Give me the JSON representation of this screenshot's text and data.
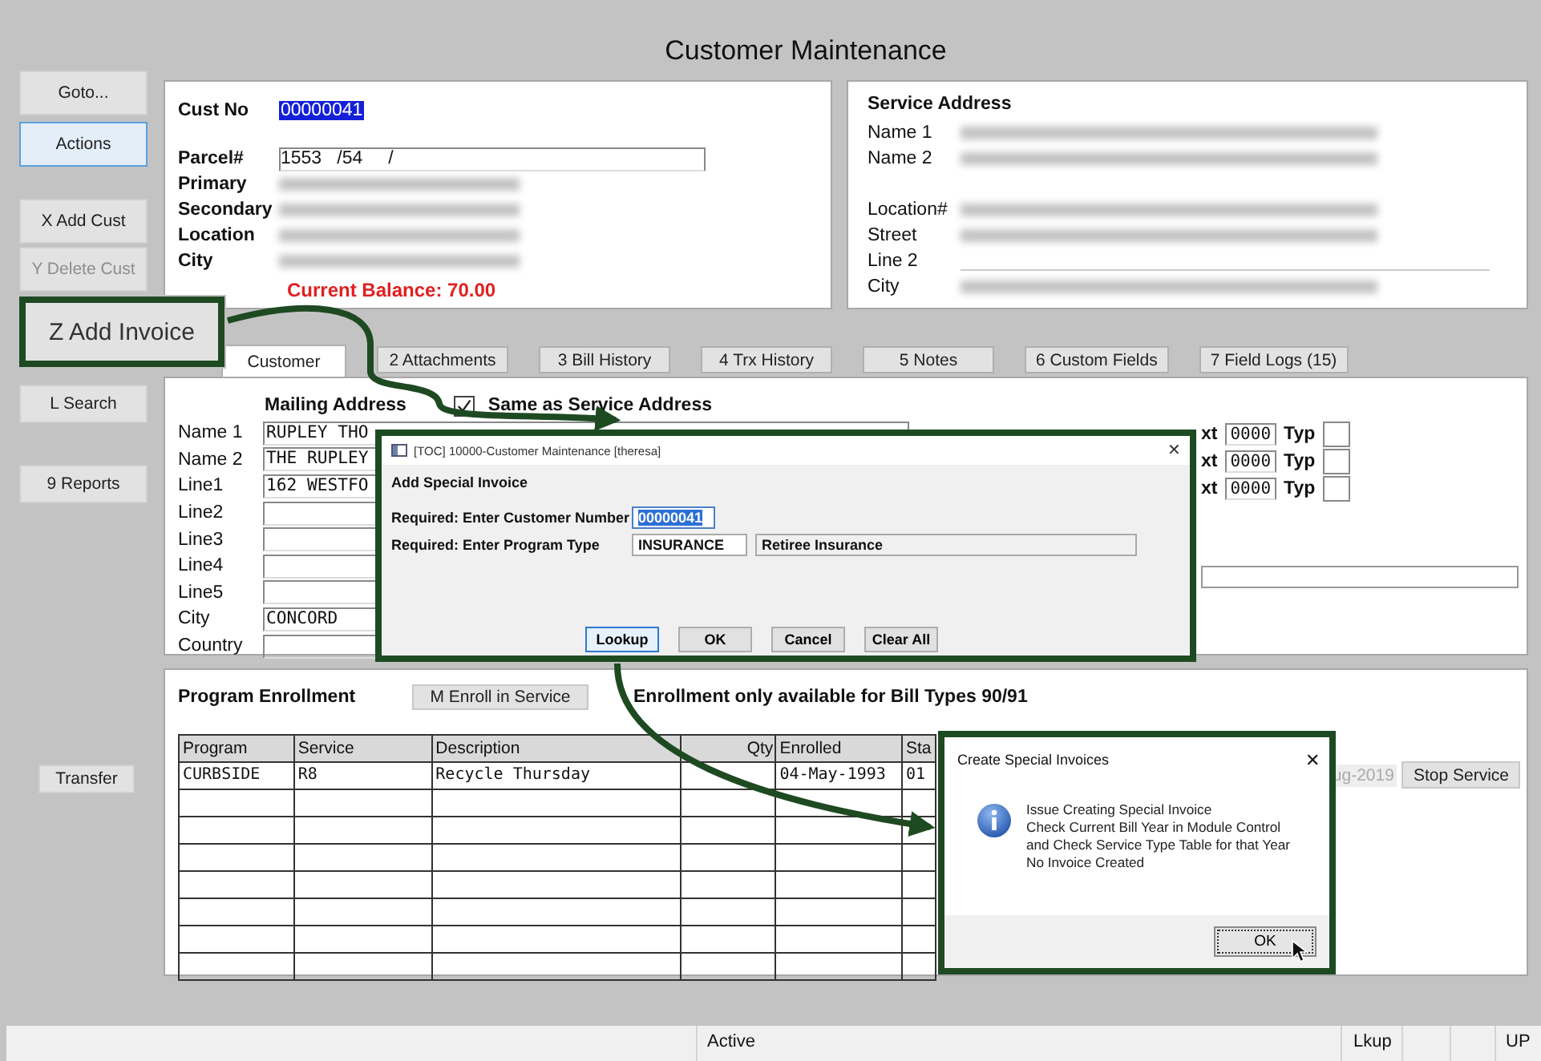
{
  "window": {
    "title": "Customer Maintenance"
  },
  "sidebar": {
    "buttons": [
      {
        "label": "Goto...",
        "kind": "button",
        "selected": false,
        "disabled": false
      },
      {
        "label": "Actions",
        "kind": "button",
        "selected": true,
        "disabled": false
      },
      {
        "label": "X Add Cust",
        "kind": "button",
        "selected": false,
        "disabled": false
      },
      {
        "label": "Y Delete Cust",
        "kind": "button",
        "selected": false,
        "disabled": true
      },
      {
        "label": "Z Add Invoice",
        "kind": "callout",
        "selected": false,
        "disabled": false
      },
      {
        "label": "L Search",
        "kind": "button",
        "selected": false,
        "disabled": false
      },
      {
        "label": "9 Reports",
        "kind": "button",
        "selected": false,
        "disabled": false
      },
      {
        "label": "Transfer",
        "kind": "button",
        "selected": false,
        "disabled": false
      }
    ]
  },
  "customer": {
    "cust_no": {
      "label": "Cust No",
      "value": "00000041",
      "highlighted": true
    },
    "fields": [
      {
        "label": "Parcel#",
        "value": "1553   /54     /",
        "redacted": false
      },
      {
        "label": "Primary",
        "redacted": true
      },
      {
        "label": "Secondary",
        "redacted": true
      },
      {
        "label": "Location",
        "redacted": true
      },
      {
        "label": "City",
        "redacted": true
      }
    ],
    "balance": "Current Balance: 70.00"
  },
  "service_address": {
    "title": "Service Address",
    "fields": [
      {
        "label": "Name 1",
        "redacted": true
      },
      {
        "label": "Name 2",
        "redacted": true
      },
      {
        "label": "Location#",
        "redacted": true
      },
      {
        "label": "Street",
        "redacted": true
      },
      {
        "label": "Line 2",
        "redacted": false
      },
      {
        "label": "City",
        "redacted": true
      }
    ]
  },
  "tabs": [
    {
      "label": "Customer",
      "selected": true
    },
    {
      "label": "2 Attachments",
      "selected": false
    },
    {
      "label": "3 Bill History",
      "selected": false
    },
    {
      "label": "4 Trx History",
      "selected": false
    },
    {
      "label": "5 Notes",
      "selected": false
    },
    {
      "label": "6 Custom Fields",
      "selected": false
    },
    {
      "label": "7 Field Logs (15)",
      "selected": false
    }
  ],
  "mailing": {
    "title": "Mailing Address",
    "same_as_service": {
      "label": "Same as Service Address",
      "checked": true
    },
    "lines": [
      {
        "label": "Name 1",
        "value": "RUPLEY THO"
      },
      {
        "label": "Name 2",
        "value": "THE RUPLEY"
      },
      {
        "label": "Line1",
        "value": "162 WESTFO"
      },
      {
        "label": "Line2"
      },
      {
        "label": "Line3"
      },
      {
        "label": "Line4"
      },
      {
        "label": "Line5"
      },
      {
        "label": "City",
        "value": "CONCORD"
      },
      {
        "label": "Country"
      }
    ],
    "ext_rows": [
      {
        "label": "xt",
        "value": "0000",
        "type_label": "Typ"
      },
      {
        "label": "xt",
        "value": "0000",
        "type_label": "Typ"
      },
      {
        "label": "xt",
        "value": "0000",
        "type_label": "Typ"
      }
    ]
  },
  "enrollment": {
    "title": "Program Enrollment",
    "button": "M Enroll in Service",
    "note": "Enrollment only available for Bill Types 90/91",
    "table": {
      "columns": [
        "Program",
        "Service",
        "Description",
        "Qty",
        "Enrolled",
        "Sta"
      ],
      "rows": [
        [
          "CURBSIDE",
          "R8",
          "Recycle Thursday",
          "",
          "04-May-1993",
          "01"
        ]
      ]
    },
    "row_tail": {
      "date": "ug-2019",
      "button": "Stop Service"
    }
  },
  "add_invoice_dialog": {
    "title": "[TOC] 10000-Customer Maintenance [theresa]",
    "close": "✕",
    "heading": "Add Special Invoice",
    "customer_label": "Required: Enter Customer Number",
    "customer_value": "00000041",
    "program_label": "Required: Enter Program Type",
    "program_value": "INSURANCE",
    "program_description": "Retiree Insurance",
    "buttons": [
      {
        "label": "Lookup",
        "focused": true
      },
      {
        "label": "OK",
        "focused": false
      },
      {
        "label": "Cancel",
        "focused": false
      },
      {
        "label": "Clear All",
        "focused": false
      }
    ]
  },
  "message_dialog": {
    "title": "Create Special Invoices",
    "close": "✕",
    "lines": [
      "Issue Creating Special Invoice",
      "Check Current Bill Year in Module Control",
      "and Check Service Type Table for that Year",
      "No Invoice Created"
    ],
    "button": "OK"
  },
  "status_bar": {
    "items": [
      "Active",
      "Lkup",
      "UP"
    ]
  }
}
